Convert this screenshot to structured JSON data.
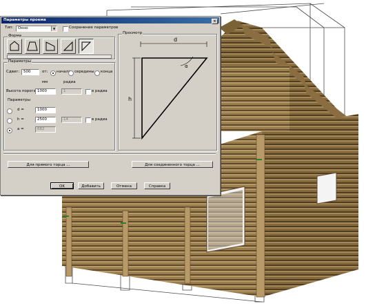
{
  "dialog": {
    "title": "Параметры проема",
    "type_label": "Тип:",
    "type_value": "Окно",
    "save_params_label": "Сохранение параметров",
    "shape_group_label": "Форма",
    "params_group_label": "Параметры",
    "shift_label": "Сдвиг:",
    "shift_value": "500",
    "from_label": "от:",
    "from_options": [
      "начала",
      "середины",
      "конца"
    ],
    "from_selected": "начала",
    "unit_mm": "мм",
    "unit_rad": "радиа",
    "sill_label": "Высота порога:",
    "sill_value": "1000",
    "sill_rad_value": "1",
    "in_rad_label": "в радиа",
    "params2_label": "Параметры",
    "d_label": "d =",
    "d_value": "1000",
    "h_label": "h =",
    "h_value": "2500",
    "h_rad_value": "14",
    "in_rad2_label": "в радиа",
    "a_label": "a =",
    "a_value": "682",
    "preview_label": "Просмотр",
    "preview_d": "d",
    "preview_h": "h",
    "preview_a": "α",
    "straight_end_btn": "Для прямого торца ...",
    "joined_end_btn": "Для соединенного торца ...",
    "ok_btn": "OK",
    "add_btn": "Добавить",
    "cancel_btn": "Отмена",
    "help_btn": "Справка"
  },
  "colors": {
    "log": "#9a7d4c",
    "log_dark": "#6b5430",
    "log_light": "#b89968",
    "dialog_bg": "#d4d0c8",
    "title_start": "#0a246a",
    "title_end": "#3a6ea5"
  }
}
